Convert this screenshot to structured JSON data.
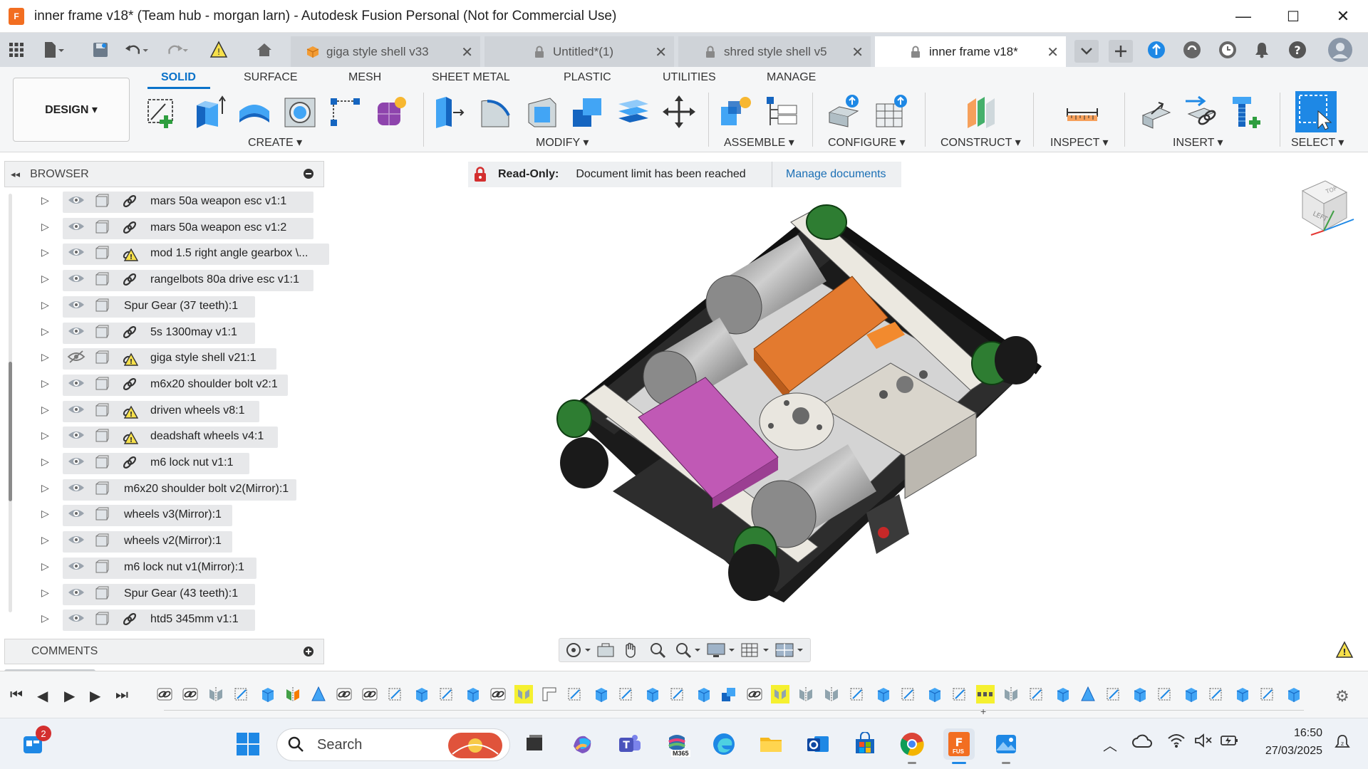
{
  "window": {
    "title": "inner frame v18* (Team hub - morgan larn) - Autodesk Fusion Personal (Not for Commercial Use)",
    "app_icon_text": "F",
    "minimize": "—",
    "maximize": "☐",
    "close": "✕"
  },
  "tabs": [
    {
      "label": "giga style shell v33",
      "icon": "cube-icon",
      "close": "✕"
    },
    {
      "label": "Untitled*(1)",
      "icon": "lock-icon",
      "close": "✕"
    },
    {
      "label": "shred style shell v5",
      "icon": "lock-icon",
      "close": "✕"
    },
    {
      "label": "inner frame v18*",
      "icon": "lock-icon",
      "close": "✕"
    }
  ],
  "ribbon": {
    "workspace": "DESIGN ▾",
    "tabs": [
      "SOLID",
      "SURFACE",
      "MESH",
      "SHEET METAL",
      "PLASTIC",
      "UTILITIES",
      "MANAGE"
    ],
    "groups": [
      "CREATE ▾",
      "MODIFY ▾",
      "ASSEMBLE ▾",
      "CONFIGURE ▾",
      "CONSTRUCT ▾",
      "INSPECT ▾",
      "INSERT ▾",
      "SELECT ▾"
    ]
  },
  "browser": {
    "title": "BROWSER",
    "collapse": "◂◂",
    "items": [
      {
        "label": "mars 50a weapon esc v1:1",
        "extra": "link"
      },
      {
        "label": "mars 50a weapon esc v1:2",
        "extra": "link"
      },
      {
        "label": "mod 1.5 right angle gearbox \\...",
        "extra": "warning"
      },
      {
        "label": "rangelbots 80a drive esc v1:1",
        "extra": "link"
      },
      {
        "label": "Spur Gear (37 teeth):1",
        "extra": "none"
      },
      {
        "label": "5s 1300may v1:1",
        "extra": "link"
      },
      {
        "label": "giga style shell v21:1",
        "extra": "warning",
        "hidden": true
      },
      {
        "label": "m6x20 shoulder bolt v2:1",
        "extra": "link"
      },
      {
        "label": "driven wheels v8:1",
        "extra": "warning"
      },
      {
        "label": "deadshaft wheels v4:1",
        "extra": "warning"
      },
      {
        "label": "m6 lock nut v1:1",
        "extra": "link"
      },
      {
        "label": "m6x20 shoulder bolt v2(Mirror):1",
        "extra": "none"
      },
      {
        "label": "wheels v3(Mirror):1",
        "extra": "none"
      },
      {
        "label": "wheels v2(Mirror):1",
        "extra": "none"
      },
      {
        "label": "m6 lock nut v1(Mirror):1",
        "extra": "none"
      },
      {
        "label": "Spur Gear (43 teeth):1",
        "extra": "none"
      },
      {
        "label": "htd5 345mm v1:1",
        "extra": "link"
      }
    ]
  },
  "comments": {
    "title": "COMMENTS"
  },
  "banner": {
    "label": "Read-Only:",
    "message": "Document limit has been reached",
    "link": "Manage documents"
  },
  "viewcube": {
    "face_left": "LEFT",
    "face_top": "TOP"
  },
  "taskbar": {
    "search_placeholder": "Search",
    "badge_count": "2",
    "m365_label": "M365",
    "fusion_label": "FUS",
    "time": "16:50",
    "date": "27/03/2025"
  },
  "colors": {
    "accent": "#0a72c9",
    "fusion_orange": "#f26e21",
    "timeline_highlight": "#f5f030",
    "readonly_red": "#d32f2f"
  }
}
